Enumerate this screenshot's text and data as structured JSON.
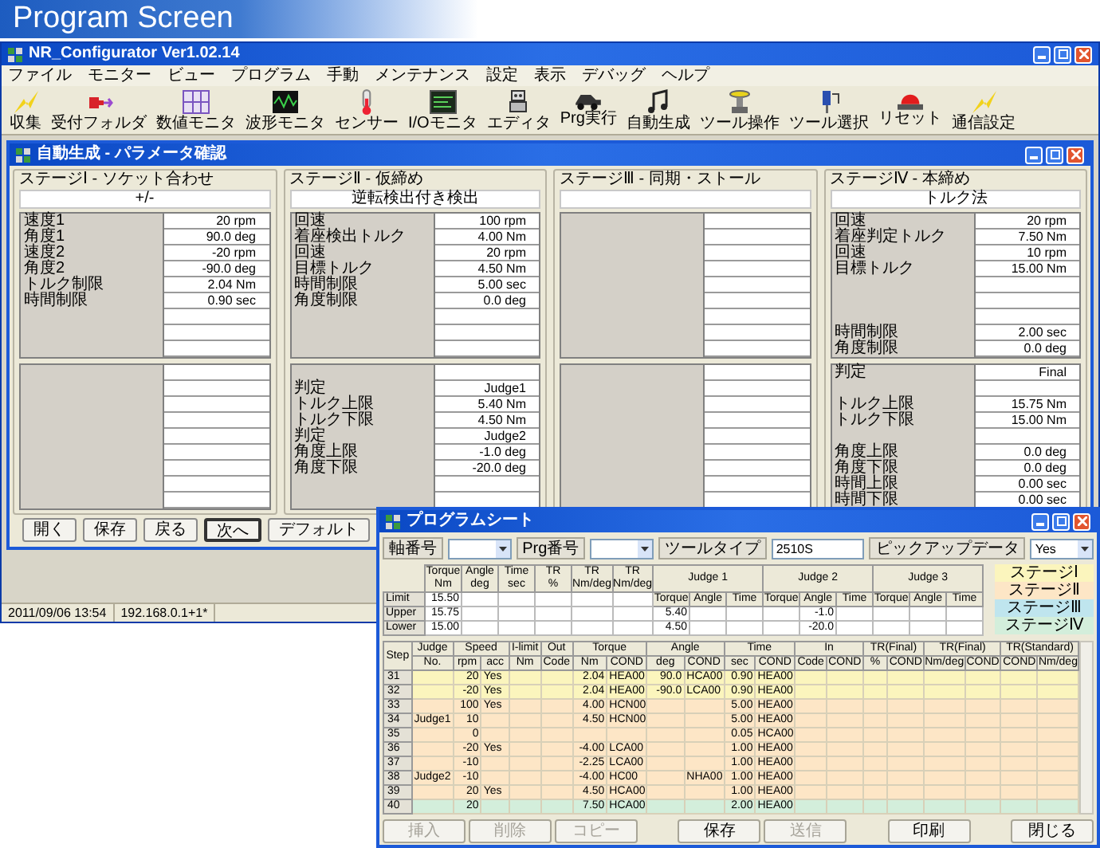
{
  "banner": {
    "title": "Program Screen"
  },
  "main_window": {
    "title": "NR_Configurator  Ver1.02.14",
    "menu": [
      "ファイル",
      "モニター",
      "ビュー",
      "プログラム",
      "手動",
      "メンテナンス",
      "設定",
      "表示",
      "デバッグ",
      "ヘルプ"
    ],
    "toolbar": [
      {
        "label": "収集",
        "kind": "lightning"
      },
      {
        "label": "受付フォルダ",
        "kind": "connector"
      },
      {
        "label": "数値モニタ",
        "kind": "digits"
      },
      {
        "label": "波形モニタ",
        "kind": "waveform"
      },
      {
        "label": "センサー",
        "kind": "thermometer"
      },
      {
        "label": "I/Oモニタ",
        "kind": "io"
      },
      {
        "label": "エディタ",
        "kind": "robot"
      },
      {
        "label": "Prg実行",
        "kind": "vehicle"
      },
      {
        "label": "自動生成",
        "kind": "note"
      },
      {
        "label": "ツール操作",
        "kind": "tool"
      },
      {
        "label": "ツール選択",
        "kind": "driver"
      },
      {
        "label": "リセット",
        "kind": "beacon"
      },
      {
        "label": "通信設定",
        "kind": "lightning"
      }
    ],
    "dialog": {
      "title": "自動生成 - パラメータ確認",
      "stages": [
        {
          "title": "ステージⅠ - ソケット合わせ",
          "mode": "+/-",
          "upper": [
            {
              "kind": "param",
              "label": "速度1",
              "value": "20 rpm"
            },
            {
              "kind": "param",
              "label": "角度1",
              "value": "90.0 deg"
            },
            {
              "kind": "param",
              "label": "速度2",
              "value": "-20 rpm"
            },
            {
              "kind": "param",
              "label": "角度2",
              "value": "-90.0 deg"
            },
            {
              "kind": "param",
              "label": "トルク制限",
              "value": "2.04 Nm"
            },
            {
              "kind": "param",
              "label": "時間制限",
              "value": "0.90 sec"
            },
            {
              "kind": "blank"
            },
            {
              "kind": "blank"
            },
            {
              "kind": "blank"
            }
          ],
          "lower": [
            {
              "kind": "blank"
            },
            {
              "kind": "blank"
            },
            {
              "kind": "blank"
            },
            {
              "kind": "blank"
            },
            {
              "kind": "blank"
            },
            {
              "kind": "blank"
            },
            {
              "kind": "blank"
            },
            {
              "kind": "blank"
            },
            {
              "kind": "blank"
            }
          ]
        },
        {
          "title": "ステージⅡ - 仮締め",
          "mode": "逆転検出付き検出",
          "upper": [
            {
              "kind": "param",
              "label": "回速",
              "value": "100 rpm"
            },
            {
              "kind": "param",
              "label": "着座検出トルク",
              "value": "4.00 Nm"
            },
            {
              "kind": "param",
              "label": "回速",
              "value": "20 rpm"
            },
            {
              "kind": "param",
              "label": "目標トルク",
              "value": "4.50 Nm"
            },
            {
              "kind": "param",
              "label": "時間制限",
              "value": "5.00 sec"
            },
            {
              "kind": "param",
              "label": "角度制限",
              "value": "0.0 deg"
            },
            {
              "kind": "blank"
            },
            {
              "kind": "blank"
            },
            {
              "kind": "blank"
            }
          ],
          "lower": [
            {
              "kind": "blank"
            },
            {
              "kind": "param",
              "label": "判定",
              "value": "Judge1"
            },
            {
              "kind": "param",
              "label": "トルク上限",
              "value": "5.40 Nm"
            },
            {
              "kind": "param",
              "label": "トルク下限",
              "value": "4.50 Nm"
            },
            {
              "kind": "param",
              "label": "判定",
              "value": "Judge2"
            },
            {
              "kind": "param",
              "label": "角度上限",
              "value": "-1.0 deg"
            },
            {
              "kind": "param",
              "label": "角度下限",
              "value": "-20.0 deg"
            },
            {
              "kind": "blank"
            },
            {
              "kind": "blank"
            }
          ]
        },
        {
          "title": "ステージⅢ - 同期・ストール",
          "upper": [
            {
              "kind": "blank"
            },
            {
              "kind": "blank"
            },
            {
              "kind": "blank"
            },
            {
              "kind": "blank"
            },
            {
              "kind": "blank"
            },
            {
              "kind": "blank"
            },
            {
              "kind": "blank"
            },
            {
              "kind": "blank"
            },
            {
              "kind": "blank"
            }
          ],
          "lower": [
            {
              "kind": "blank"
            },
            {
              "kind": "blank"
            },
            {
              "kind": "blank"
            },
            {
              "kind": "blank"
            },
            {
              "kind": "blank"
            },
            {
              "kind": "blank"
            },
            {
              "kind": "blank"
            },
            {
              "kind": "blank"
            },
            {
              "kind": "blank"
            }
          ]
        },
        {
          "title": "ステージⅣ - 本締め",
          "mode": "トルク法",
          "upper": [
            {
              "kind": "param",
              "label": "回速",
              "value": "20 rpm"
            },
            {
              "kind": "param",
              "label": "着座判定トルク",
              "value": "7.50 Nm"
            },
            {
              "kind": "param",
              "label": "回速",
              "value": "10 rpm"
            },
            {
              "kind": "param",
              "label": "目標トルク",
              "value": "15.00 Nm"
            },
            {
              "kind": "blank"
            },
            {
              "kind": "blank"
            },
            {
              "kind": "blank"
            },
            {
              "kind": "param",
              "label": "時間制限",
              "value": "2.00 sec"
            },
            {
              "kind": "param",
              "label": "角度制限",
              "value": "0.0 deg"
            }
          ],
          "lower": [
            {
              "kind": "param",
              "label": "判定",
              "value": "Final"
            },
            {
              "kind": "blank"
            },
            {
              "kind": "param",
              "label": "トルク上限",
              "value": "15.75 Nm"
            },
            {
              "kind": "param",
              "label": "トルク下限",
              "value": "15.00 Nm"
            },
            {
              "kind": "blank"
            },
            {
              "kind": "param",
              "label": "角度上限",
              "value": "0.0 deg"
            },
            {
              "kind": "param",
              "label": "角度下限",
              "value": "0.0 deg"
            },
            {
              "kind": "param",
              "label": "時間上限",
              "value": "0.00 sec"
            },
            {
              "kind": "param",
              "label": "時間下限",
              "value": "0.00 sec"
            }
          ]
        }
      ],
      "buttons": [
        {
          "label": "開く",
          "selected": false
        },
        {
          "label": "保存",
          "selected": false
        },
        {
          "label": "戻る",
          "selected": false
        },
        {
          "label": "次へ",
          "selected": true
        },
        {
          "label": "デフォルト",
          "selected": false
        }
      ]
    },
    "status_bar": [
      "2011/09/06 13:54",
      "192.168.0.1+1*"
    ]
  },
  "program_sheet": {
    "title": "プログラムシート",
    "controls": [
      {
        "label": "軸番号",
        "kind": "dropdown"
      },
      {
        "label": "Prg番号",
        "kind": "dropdown"
      },
      {
        "label": "ツールタイプ",
        "kind": "text",
        "value": "2510S"
      },
      {
        "label": "ピックアップデータ",
        "kind": "dropdown",
        "value": "Yes"
      }
    ],
    "limit_table": {
      "columns": [
        {
          "name": "Torque",
          "unit": "Nm"
        },
        {
          "name": "Angle",
          "unit": "deg"
        },
        {
          "name": "Time",
          "unit": "sec"
        },
        {
          "name": "TR",
          "unit": "%"
        },
        {
          "name": "TR",
          "unit": "Nm/deg"
        },
        {
          "name": "TR",
          "unit": "Nm/deg"
        }
      ],
      "judges": [
        {
          "name": "Judge 1",
          "columns": [
            "Torque",
            "Angle",
            "Time"
          ]
        },
        {
          "name": "Judge 2",
          "columns": [
            "Torque",
            "Angle",
            "Time"
          ]
        },
        {
          "name": "Judge 3",
          "columns": [
            "Torque",
            "Angle",
            "Time"
          ]
        }
      ],
      "rows": [
        {
          "label": "Limit",
          "kind": "limit",
          "cells": {
            "0": "15.50"
          }
        },
        {
          "label": "Upper",
          "kind": "value",
          "cells": {
            "0": "15.75",
            "6": "5.40",
            "10": "-1.0"
          }
        },
        {
          "label": "Lower",
          "kind": "value",
          "cells": {
            "0": "15.00",
            "6": "4.50",
            "10": "-20.0"
          }
        }
      ]
    },
    "legend": [
      {
        "label": "ステージⅠ",
        "color": "#fbf5bd"
      },
      {
        "label": "ステージⅡ",
        "color": "#fde6c6"
      },
      {
        "label": "ステージⅢ",
        "color": "#bfe5ee"
      },
      {
        "label": "ステージⅣ",
        "color": "#d3eedb"
      }
    ],
    "step_table": {
      "step_header": "Step",
      "groups": [
        {
          "label": "Judge",
          "columns": [
            "No."
          ]
        },
        {
          "label": "Speed",
          "columns": [
            "rpm",
            "acc"
          ]
        },
        {
          "label": "I-limit",
          "columns": [
            "Nm"
          ]
        },
        {
          "label": "Out",
          "columns": [
            "Code"
          ]
        },
        {
          "label": "Torque",
          "columns": [
            "Nm",
            "COND"
          ]
        },
        {
          "label": "Angle",
          "columns": [
            "deg",
            "COND"
          ]
        },
        {
          "label": "Time",
          "columns": [
            "sec",
            "COND"
          ]
        },
        {
          "label": "In",
          "columns": [
            "Code",
            "COND"
          ]
        },
        {
          "label": "TR(Final)",
          "columns": [
            "%",
            "COND"
          ]
        },
        {
          "label": "TR(Final)",
          "columns": [
            "Nm/deg",
            "COND"
          ]
        },
        {
          "label": "TR(Standard)",
          "columns": [
            "COND",
            "Nm/deg"
          ]
        }
      ],
      "rows": [
        {
          "step": "31",
          "color": "#fbf5bd",
          "cells": {
            "1": "20",
            "2": "Yes",
            "5": "2.04",
            "6": "HEA00",
            "7": "90.0",
            "8": "HCA00",
            "9": "0.90",
            "10": "HEA00"
          }
        },
        {
          "step": "32",
          "color": "#fbf5bd",
          "cells": {
            "1": "-20",
            "2": "Yes",
            "5": "2.04",
            "6": "HEA00",
            "7": "-90.0",
            "8": "LCA00",
            "9": "0.90",
            "10": "HEA00"
          }
        },
        {
          "step": "33",
          "color": "#fde6c6",
          "cells": {
            "1": "100",
            "2": "Yes",
            "5": "4.00",
            "6": "HCN00",
            "9": "5.00",
            "10": "HEA00"
          }
        },
        {
          "step": "34",
          "color": "#fde6c6",
          "cells": {
            "0": "Judge1",
            "1": "10",
            "5": "4.50",
            "6": "HCN00",
            "9": "5.00",
            "10": "HEA00"
          }
        },
        {
          "step": "35",
          "color": "#fde6c6",
          "cells": {
            "1": "0",
            "9": "0.05",
            "10": "HCA00"
          }
        },
        {
          "step": "36",
          "color": "#fde6c6",
          "cells": {
            "1": "-20",
            "2": "Yes",
            "5": "-4.00",
            "6": "LCA00",
            "9": "1.00",
            "10": "HEA00"
          }
        },
        {
          "step": "37",
          "color": "#fde6c6",
          "cells": {
            "1": "-10",
            "5": "-2.25",
            "6": "LCA00",
            "9": "1.00",
            "10": "HEA00"
          }
        },
        {
          "step": "38",
          "color": "#fde6c6",
          "cells": {
            "0": "Judge2",
            "1": "-10",
            "5": "-4.00",
            "6": "HC00",
            "8": "NHA00",
            "9": "1.00",
            "10": "HEA00"
          }
        },
        {
          "step": "39",
          "color": "#fde6c6",
          "cells": {
            "1": "20",
            "2": "Yes",
            "5": "4.50",
            "6": "HCA00",
            "9": "1.00",
            "10": "HEA00"
          }
        },
        {
          "step": "40",
          "color": "#d3eedb",
          "cells": {
            "1": "20",
            "5": "7.50",
            "6": "HCA00",
            "9": "2.00",
            "10": "HEA00"
          }
        }
      ]
    },
    "buttons": [
      {
        "label": "挿入",
        "disabled": true
      },
      {
        "label": "削除",
        "disabled": true
      },
      {
        "label": "コピー",
        "disabled": true
      },
      {
        "label": "保存",
        "disabled": false
      },
      {
        "label": "送信",
        "disabled": true
      },
      {
        "label": "印刷",
        "disabled": false
      },
      {
        "label": "閉じる",
        "disabled": false
      }
    ]
  }
}
